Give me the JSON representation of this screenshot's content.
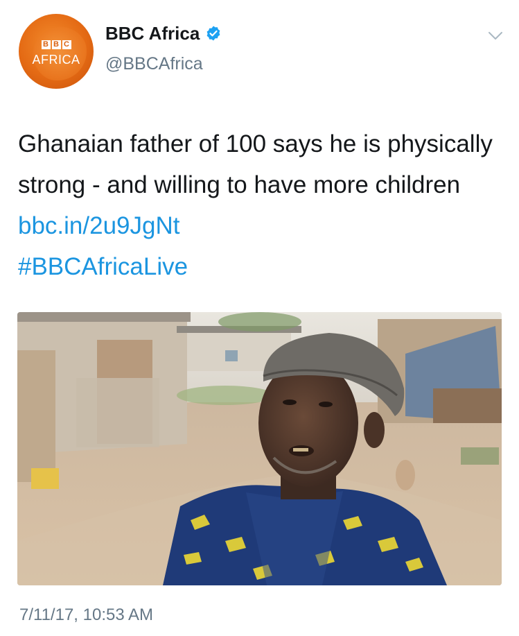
{
  "account": {
    "avatar_brand": "BBC",
    "avatar_brand_letters": [
      "B",
      "B",
      "C"
    ],
    "avatar_label": "AFRICA",
    "avatar_icon": "bbc-africa-logo",
    "display_name": "BBC Africa",
    "verified_icon": "verified-badge-icon",
    "handle": "@BBCAfrica"
  },
  "menu": {
    "icon": "chevron-down-icon"
  },
  "tweet": {
    "text_plain": "Ghanaian father of 100 says he is physically strong - and willing to have more children",
    "link": "bbc.in/2u9JgNt",
    "hashtag": "#BBCAfricaLive",
    "timestamp": "7/11/17, 10:53 AM"
  },
  "media": {
    "type": "photo"
  },
  "colors": {
    "link": "#1b95e0",
    "text": "#14171a",
    "secondary": "#657786",
    "brand_orange": "#e46a14",
    "verified": "#1da1f2"
  }
}
